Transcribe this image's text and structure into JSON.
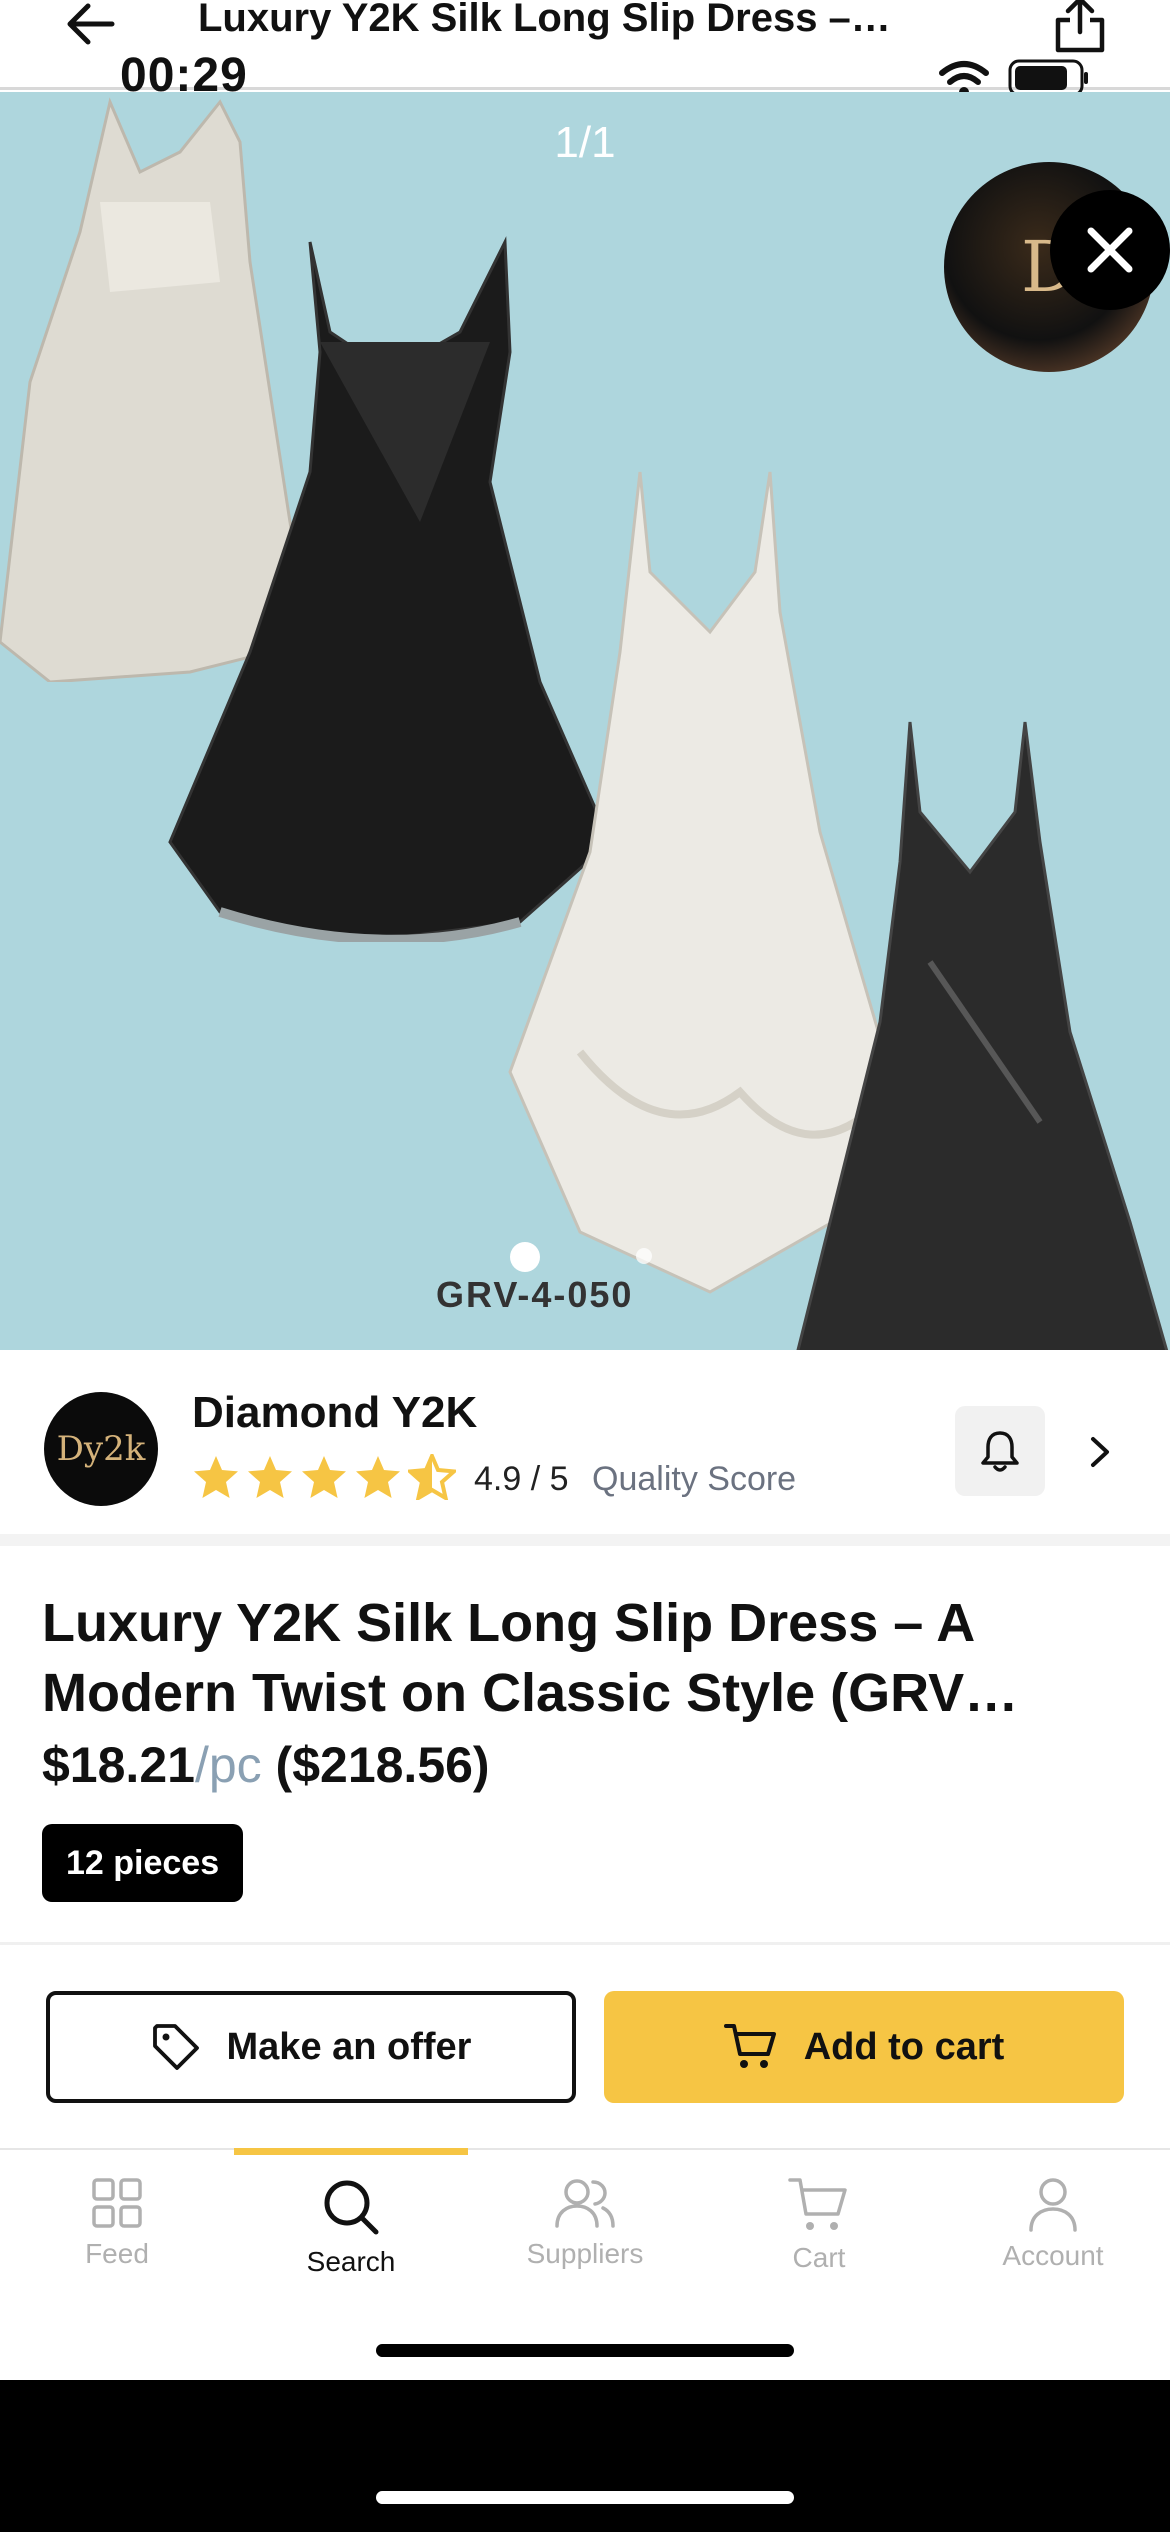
{
  "nav": {
    "title": "Luxury Y2K Silk Long Slip Dress –…"
  },
  "status": {
    "time": "00:29"
  },
  "gallery": {
    "counter": "1/1",
    "sku": "GRV-4-050",
    "badge_letter": "D"
  },
  "seller": {
    "name": "Diamond Y2K",
    "avatar_text": "Dy2k",
    "rating": "4.9 / 5",
    "rating_value": 4.5,
    "quality_label": "Quality Score"
  },
  "product": {
    "title": "Luxury Y2K Silk Long Slip Dress – A Modern Twist on Classic Style (GRV…",
    "unit_price": "$18.21",
    "per_unit": "/pc",
    "total_price": "($218.56)",
    "pieces": "12 pieces"
  },
  "actions": {
    "offer_label": "Make an offer",
    "cart_label": "Add to cart"
  },
  "tabs": [
    {
      "label": "Feed",
      "icon": "grid-icon"
    },
    {
      "label": "Search",
      "icon": "search-icon"
    },
    {
      "label": "Suppliers",
      "icon": "users-icon"
    },
    {
      "label": "Cart",
      "icon": "cart-icon"
    },
    {
      "label": "Account",
      "icon": "user-icon"
    }
  ],
  "colors": {
    "accent": "#f6c544",
    "hero_bg": "#aed6dd",
    "muted": "#b0b0b0"
  }
}
